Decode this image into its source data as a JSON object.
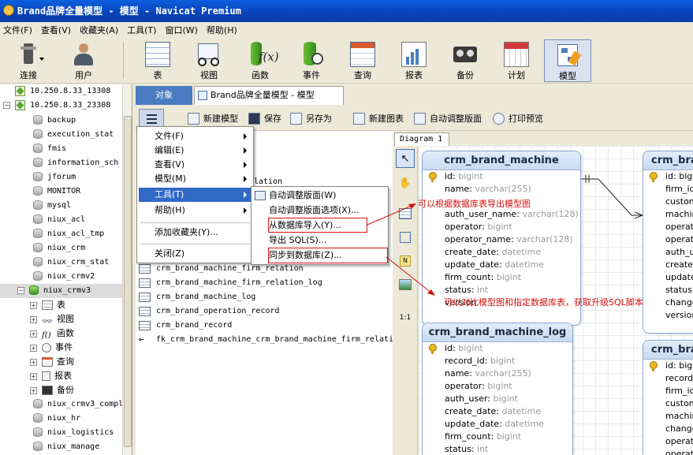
{
  "window": {
    "title": "Brand品牌全量模型 - 模型 - Navicat Premium"
  },
  "menubar": [
    "文件(F)",
    "查看(V)",
    "收藏夹(A)",
    "工具(T)",
    "窗口(W)",
    "帮助(H)"
  ],
  "toolbar": [
    {
      "label": "连接",
      "icon": "plug-icon"
    },
    {
      "label": "用户",
      "icon": "user-icon"
    },
    {
      "label": "表",
      "icon": "table-icon"
    },
    {
      "label": "视图",
      "icon": "view-glasses-icon"
    },
    {
      "label": "函数",
      "icon": "function-icon"
    },
    {
      "label": "事件",
      "icon": "event-icon"
    },
    {
      "label": "查询",
      "icon": "query-icon"
    },
    {
      "label": "报表",
      "icon": "report-icon"
    },
    {
      "label": "备份",
      "icon": "backup-icon"
    },
    {
      "label": "计划",
      "icon": "calendar-icon"
    },
    {
      "label": "模型",
      "icon": "model-icon"
    }
  ],
  "nav": {
    "connections": [
      "10.250.8.33_13308",
      "10.250.8.33_23308"
    ],
    "databases_top": [
      "backup",
      "execution_stat",
      "fmis",
      "information_sch",
      "jforum",
      "MONITOR",
      "mysql",
      "niux_acl",
      "niux_acl_tmp",
      "niux_crm",
      "niux_crm_stat",
      "niux_crmv2"
    ],
    "selected_db": "niux_crmv3",
    "db_children": [
      "表",
      "视图",
      "函数",
      "事件",
      "查询",
      "报表",
      "备份"
    ],
    "databases_bottom": [
      "niux_crmv3_compl",
      "niux_hr",
      "niux_logistics",
      "niux_manage"
    ]
  },
  "tabs": {
    "objects": "对象",
    "model": "Brand品牌全量模型 - 模型"
  },
  "subtoolbar": {
    "new_model": "新建模型",
    "save": "保存",
    "save_as": "另存为",
    "new_diagram": "新建图表",
    "auto_layout": "自动调整版面",
    "print_preview": "打印预览"
  },
  "object_list": {
    "partial": "lation",
    "items": [
      "crm_brand_machine_firm_relation",
      "crm_brand_machine_firm_relation_log",
      "crm_brand_machine_log",
      "crm_brand_operation_record",
      "crm_brand_record"
    ],
    "fk": "fk_crm_brand_machine_crm_brand_machine_firm_relati"
  },
  "main_menu": {
    "items": [
      "文件(F)",
      "编辑(E)",
      "查看(V)",
      "模型(M)",
      "工具(T)",
      "帮助(H)",
      "添加收藏夹(Y)...",
      "关闭(Z)"
    ]
  },
  "tools_submenu": {
    "items": [
      "自动调整版面(W)",
      "自动调整版面选项(X)...",
      "从数据库导入(Y)...",
      "导出 SQL(S)...",
      "同步到数据库(Z)..."
    ]
  },
  "diagram": {
    "tab": "Diagram 1",
    "entities": [
      {
        "name": "crm_brand_machine",
        "fields": [
          {
            "name": "id",
            "type": "bigint",
            "key": true
          },
          {
            "name": "name",
            "type": "varchar(255)"
          },
          {
            "name": "",
            "type": ""
          },
          {
            "name": "auth_user_name",
            "type": "varchar(128)"
          },
          {
            "name": "operator",
            "type": "bigint"
          },
          {
            "name": "operator_name",
            "type": "varchar(128)"
          },
          {
            "name": "create_date",
            "type": "datetime"
          },
          {
            "name": "update_date",
            "type": "datetime"
          },
          {
            "name": "firm_count",
            "type": "bigint"
          },
          {
            "name": "status",
            "type": "int"
          },
          {
            "name": "version",
            "type": ""
          }
        ]
      },
      {
        "name": "crm_brand_machine_log",
        "fields": [
          {
            "name": "id",
            "type": "bigint",
            "key": true
          },
          {
            "name": "record_id",
            "type": "bigint"
          },
          {
            "name": "name",
            "type": "varchar(255)"
          },
          {
            "name": "operator",
            "type": "bigint"
          },
          {
            "name": "auth_user",
            "type": "bigint"
          },
          {
            "name": "create_date",
            "type": "datetime"
          },
          {
            "name": "update_date",
            "type": "datetime"
          },
          {
            "name": "firm_count",
            "type": "bigint"
          },
          {
            "name": "status",
            "type": "int"
          }
        ]
      },
      {
        "name": "crm_bra",
        "fields": [
          "id: bigi",
          "firm_id",
          "custom",
          "machin",
          "operat",
          "operat",
          "auth_u",
          "create_",
          "update",
          "status",
          "change",
          "version"
        ]
      },
      {
        "name": "crm_bra",
        "fields": [
          "id: bigi",
          "record_",
          "firm_id",
          "custom",
          "machin",
          "change",
          "operat",
          "operat"
        ]
      }
    ]
  },
  "annotations": {
    "import": "可以根据数据库表导出模型图",
    "sync": "可以对比模型图和指定数据库表，获取升级SQL脚本"
  }
}
